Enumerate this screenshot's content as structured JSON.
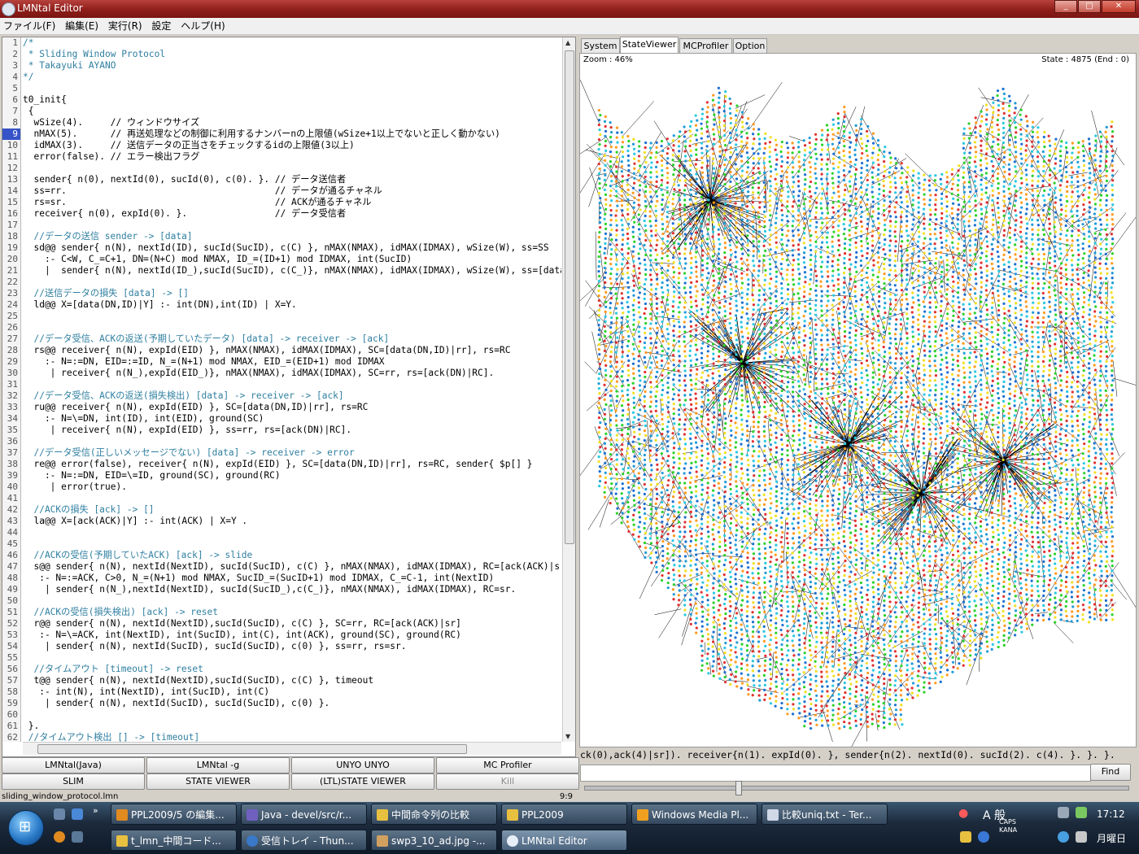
{
  "window": {
    "title": "LMNtal Editor",
    "min": "_",
    "max": "□",
    "close": "✕"
  },
  "menu": [
    "ファイル(F)",
    "編集(E)",
    "実行(R)",
    "設定",
    "ヘルプ(H)"
  ],
  "editor": {
    "current_line": 9,
    "lines": [
      "/*",
      " * Sliding Window Protocol",
      " * Takayuki AYANO",
      "*/",
      "",
      "t0_init{",
      " {",
      "  wSize(4).     // ウィンドウサイズ",
      "  nMAX(5).      // 再送処理などの制御に利用するナンバーnの上限値(wSize+1以上でないと正しく動かない)",
      "  idMAX(3).     // 送信データの正当さをチェックするidの上限値(3以上)",
      "  error(false). // エラー検出フラグ",
      "",
      "  sender{ n(0), nextId(0), sucId(0), c(0). }. // データ送信者",
      "  ss=rr.                                      // データが通るチャネル",
      "  rs=sr.                                      // ACKが通るチャネル",
      "  receiver{ n(0), expId(0). }.                // データ受信者",
      "",
      "  //データの送信 sender -> [data]",
      "  sd@@ sender{ n(N), nextId(ID), sucId(SucID), c(C) }, nMAX(NMAX), idMAX(IDMAX), wSize(W), ss=SS",
      "    :- C<W, C_=C+1, DN=(N+C) mod NMAX, ID_=(ID+1) mod IDMAX, int(SucID)",
      "    |  sender{ n(N), nextId(ID_),sucId(SucID), c(C_)}, nMAX(NMAX), idMAX(IDMAX), wSize(W), ss=[data",
      "",
      "  //送信データの損失 [data] -> []",
      "  ld@@ X=[data(DN,ID)|Y] :- int(DN),int(ID) | X=Y.",
      "",
      "",
      "  //データ受信、ACKの返送(予期していたデータ) [data] -> receiver -> [ack]",
      "  rs@@ receiver{ n(N), expId(EID) }, nMAX(NMAX), idMAX(IDMAX), SC=[data(DN,ID)|rr], rs=RC",
      "    :- N=:=DN, EID=:=ID, N_=(N+1) mod NMAX, EID_=(EID+1) mod IDMAX",
      "     | receiver{ n(N_),expId(EID_)}, nMAX(NMAX), idMAX(IDMAX), SC=rr, rs=[ack(DN)|RC].",
      "",
      "  //データ受信、ACKの返送(損失検出) [data] -> receiver -> [ack]",
      "  ru@@ receiver{ n(N), expId(EID) }, SC=[data(DN,ID)|rr], rs=RC",
      "    :- N=\\=DN, int(ID), int(EID), ground(SC)",
      "     | receiver{ n(N), expId(EID) }, ss=rr, rs=[ack(DN)|RC].",
      "",
      "  //データ受信(正しいメッセージでない) [data] -> receiver -> error",
      "  re@@ error(false), receiver{ n(N), expId(EID) }, SC=[data(DN,ID)|rr], rs=RC, sender{ $p[] }",
      "    :- N=:=DN, EID=\\=ID, ground(SC), ground(RC)",
      "     | error(true).",
      "",
      "  //ACKの損失 [ack] -> []",
      "  la@@ X=[ack(ACK)|Y] :- int(ACK) | X=Y .",
      "",
      "",
      "  //ACKの受信(予期していたACK) [ack] -> slide",
      "  s@@ sender{ n(N), nextId(NextID), sucId(SucID), c(C) }, nMAX(NMAX), idMAX(IDMAX), RC=[ack(ACK)|sr]",
      "   :- N=:=ACK, C>0, N_=(N+1) mod NMAX, SucID_=(SucID+1) mod IDMAX, C_=C-1, int(NextID)",
      "    | sender{ n(N_),nextId(NextID), sucId(SucID_),c(C_)}, nMAX(NMAX), idMAX(IDMAX), RC=sr.",
      "",
      "  //ACKの受信(損失検出) [ack] -> reset",
      "  r@@ sender{ n(N), nextId(NextID),sucId(SucID), c(C) }, SC=rr, RC=[ack(ACK)|sr]",
      "   :- N=\\=ACK, int(NextID), int(SucID), int(C), int(ACK), ground(SC), ground(RC)",
      "    | sender{ n(N), nextId(SucID), sucId(SucID), c(0) }, ss=rr, rs=sr.",
      "",
      "  //タイムアウト [timeout] -> reset",
      "  t@@ sender{ n(N), nextId(NextID),sucId(SucID), c(C) }, timeout",
      "   :- int(N), int(NextID), int(SucID), int(C)",
      "    | sender{ n(N), nextId(SucID), sucId(SucID), c(0) }.",
      "",
      " }.",
      " //タイムアウト検出 [] -> [timeout]"
    ]
  },
  "buttons_row1": [
    "LMNtal(Java)",
    "LMNtal -g",
    "UNYO UNYO",
    "MC Profiler"
  ],
  "buttons_row2": [
    "SLIM",
    "STATE VIEWER",
    "(LTL)STATE VIEWER",
    "Kill"
  ],
  "status": {
    "filename": "sliding_window_protocol.lmn",
    "position": "9:9"
  },
  "viewer": {
    "tabs": [
      "System",
      "StateViewer",
      "MCProfiler",
      "Option"
    ],
    "active_tab": "StateViewer",
    "zoom": "Zoom : 46%",
    "state": "State : 4875 (End : 0)",
    "node_colors": [
      "#2ad12a",
      "#f0e020",
      "#1f9ad6",
      "#ff9a1f",
      "#e03030",
      "#28c8e0",
      "#1c6fd0"
    ],
    "state_text": "ck(0),ack(4)|sr]). receiver{n(1). expId(0). }, sender{n(2). nextId(0). sucId(2). c(4). }. }. }.",
    "find_value": "",
    "find_label": "Find",
    "slider_value": 0.28
  },
  "taskbar": {
    "start_icon": "windows-orb-icon",
    "row1": [
      "PPL2009/5 の編集...",
      "Java - devel/src/r...",
      "中間命令列の比較",
      "PPL2009",
      "Windows Media Pl...",
      "比較uniq.txt - Ter..."
    ],
    "row2": [
      "t_lmn_中間コード...",
      "受信トレイ - Thun...",
      "swp3_10_ad.jpg -...",
      "LMNtal Editor"
    ],
    "active": "LMNtal Editor",
    "ime": "A 般",
    "caps": "CAPS",
    "kana": "KANA",
    "time": "17:12",
    "day": "月曜日"
  }
}
